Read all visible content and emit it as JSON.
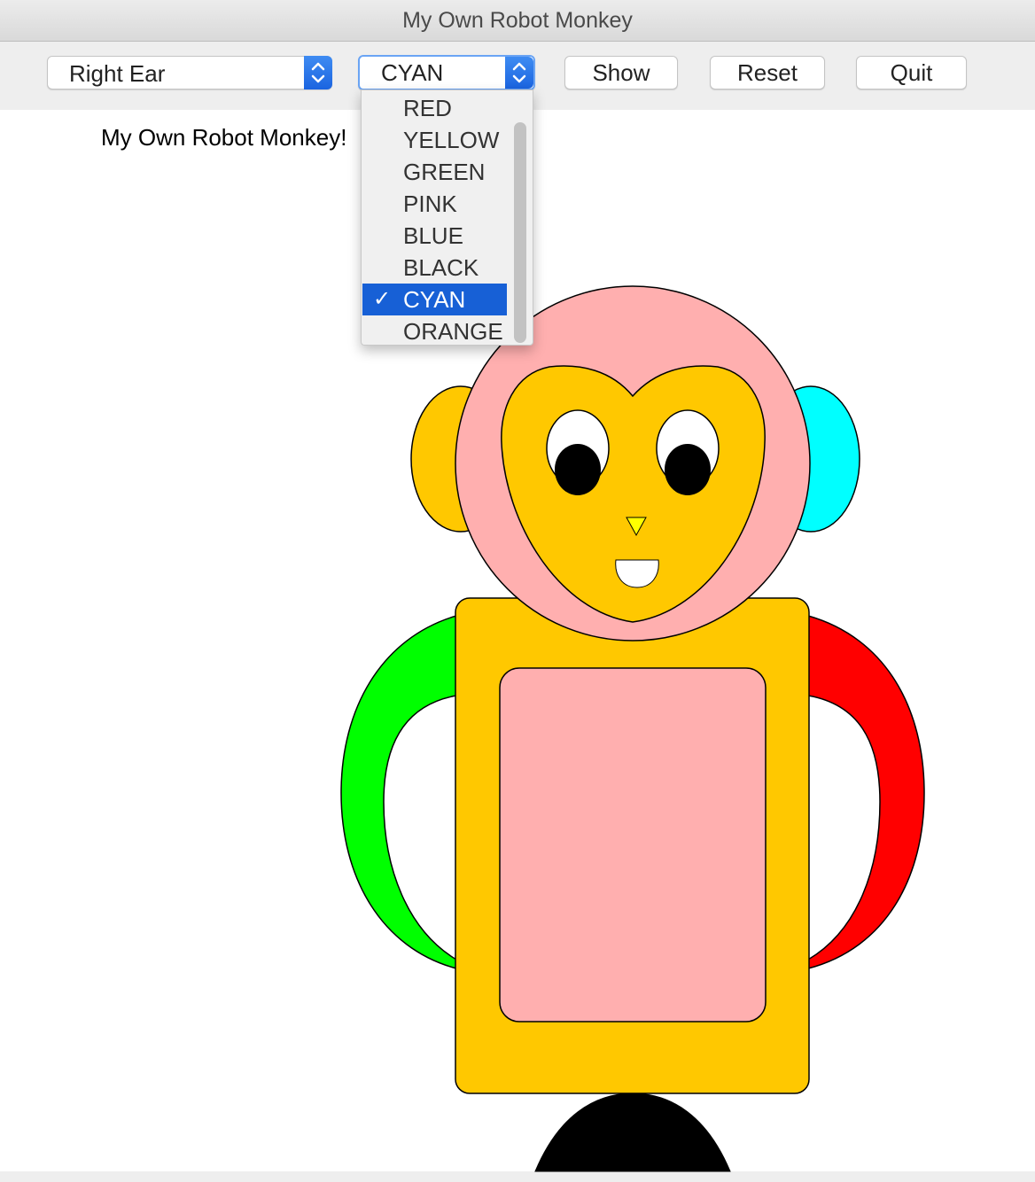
{
  "window": {
    "title": "My Own Robot Monkey"
  },
  "toolbar": {
    "part_select": {
      "value": "Right Ear"
    },
    "color_select": {
      "value": "CYAN"
    },
    "show_label": "Show",
    "reset_label": "Reset",
    "quit_label": "Quit"
  },
  "color_dropdown": {
    "options": [
      "RED",
      "YELLOW",
      "GREEN",
      "PINK",
      "BLUE",
      "BLACK",
      "CYAN",
      "ORANGE"
    ],
    "selected": "CYAN",
    "check_mark": "✓"
  },
  "canvas": {
    "title": "My Own Robot Monkey!",
    "part_colors": {
      "left_ear": "#ffc800",
      "right_ear": "#00ffff",
      "head": "#ffafaf",
      "face": "#ffc800",
      "left_arm": "#00ff00",
      "right_arm": "#ff0000",
      "body": "#ffc800",
      "belly": "#ffafaf",
      "base": "#000000",
      "nose": "#ffff00"
    }
  }
}
